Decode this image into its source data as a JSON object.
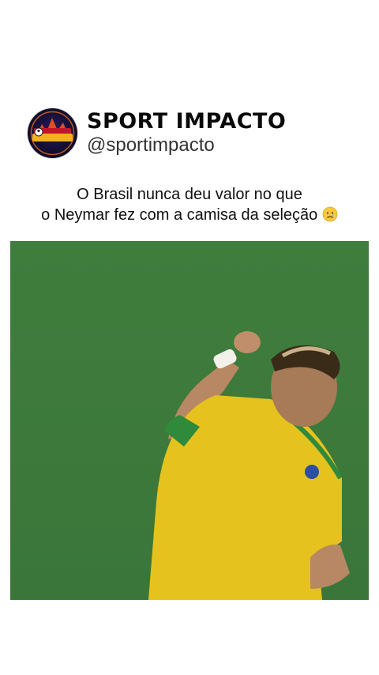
{
  "profile": {
    "display_name": "SPORT IMPACTO",
    "handle": "@sportimpacto",
    "avatar_logo_text": "SPORT IMPACTO"
  },
  "post": {
    "caption_line1": "O Brasil nunca deu valor no que",
    "caption_line2": "o Neymar fez com a camisa da seleção",
    "caption_emoji": "sad-tear-face-icon"
  },
  "colors": {
    "pitch_green": "#3d7a3c",
    "jersey_yellow": "#e8c41c",
    "background": "#ffffff"
  }
}
